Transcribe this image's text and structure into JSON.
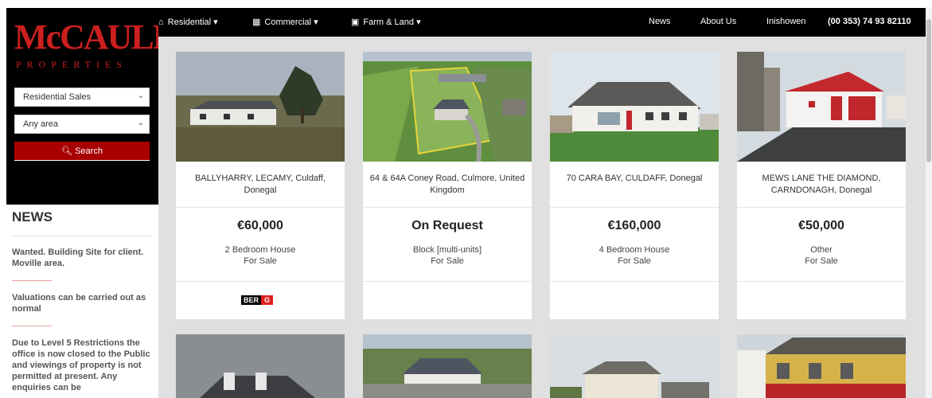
{
  "brand": {
    "logo_main": "McCAULEY",
    "logo_sub": "PROPERTIES"
  },
  "sidebar": {
    "sale_type": "Residential Sales",
    "area": "Any area",
    "search_label": "Search"
  },
  "news": {
    "title": "NEWS",
    "items": [
      "Wanted. Building Site for client. Moville area.",
      "Valuations can be carried out as normal",
      "Due to Level 5 Restrictions the office is now closed to the Public and viewings of property is not permitted at present. Any enquiries can be"
    ]
  },
  "nav": {
    "residential": "Residential",
    "commercial": "Commercial",
    "farm_land": "Farm & Land",
    "news": "News",
    "about": "About Us",
    "inishowen": "Inishowen",
    "phone": "(00 353) 74 93 82110"
  },
  "listings": [
    {
      "address": "BALLYHARRY, LECAMY, Culdaff, Donegal",
      "price": "€60,000",
      "type": "2 Bedroom House",
      "status": "For Sale",
      "ber": [
        "BER",
        "G"
      ]
    },
    {
      "address": "64 & 64A Coney Road, Culmore, United Kingdom",
      "price": "On Request",
      "type": "Block [multi-units]",
      "status": "For Sale"
    },
    {
      "address": "70 CARA BAY, CULDAFF, Donegal",
      "price": "€160,000",
      "type": "4 Bedroom House",
      "status": "For Sale"
    },
    {
      "address": "MEWS LANE THE DIAMOND, CARNDONAGH, Donegal",
      "price": "€50,000",
      "type": "Other",
      "status": "For Sale"
    }
  ],
  "colors": {
    "brand_red": "#a80000",
    "nav_bg": "#000000",
    "page_bg": "#e0e0e0"
  }
}
